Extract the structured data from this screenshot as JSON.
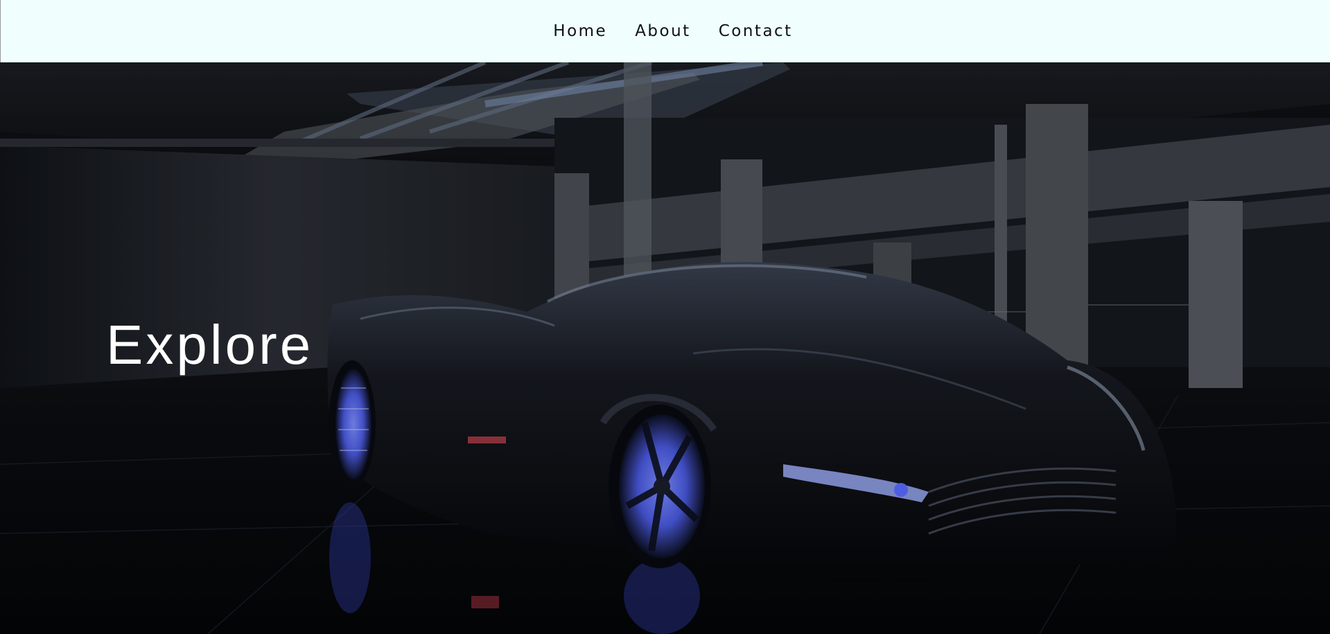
{
  "nav": {
    "items": [
      {
        "label": "Home"
      },
      {
        "label": "About"
      },
      {
        "label": "Contact"
      }
    ]
  },
  "hero": {
    "title": "Explore",
    "image_subject": "black concept supercar with glowing blue wheels in a dark concrete parking garage",
    "accent_color": "#5a6cff",
    "text_color": "#ffffff"
  },
  "colors": {
    "navbar_bg": "#f0fffe",
    "nav_text": "#111111"
  }
}
